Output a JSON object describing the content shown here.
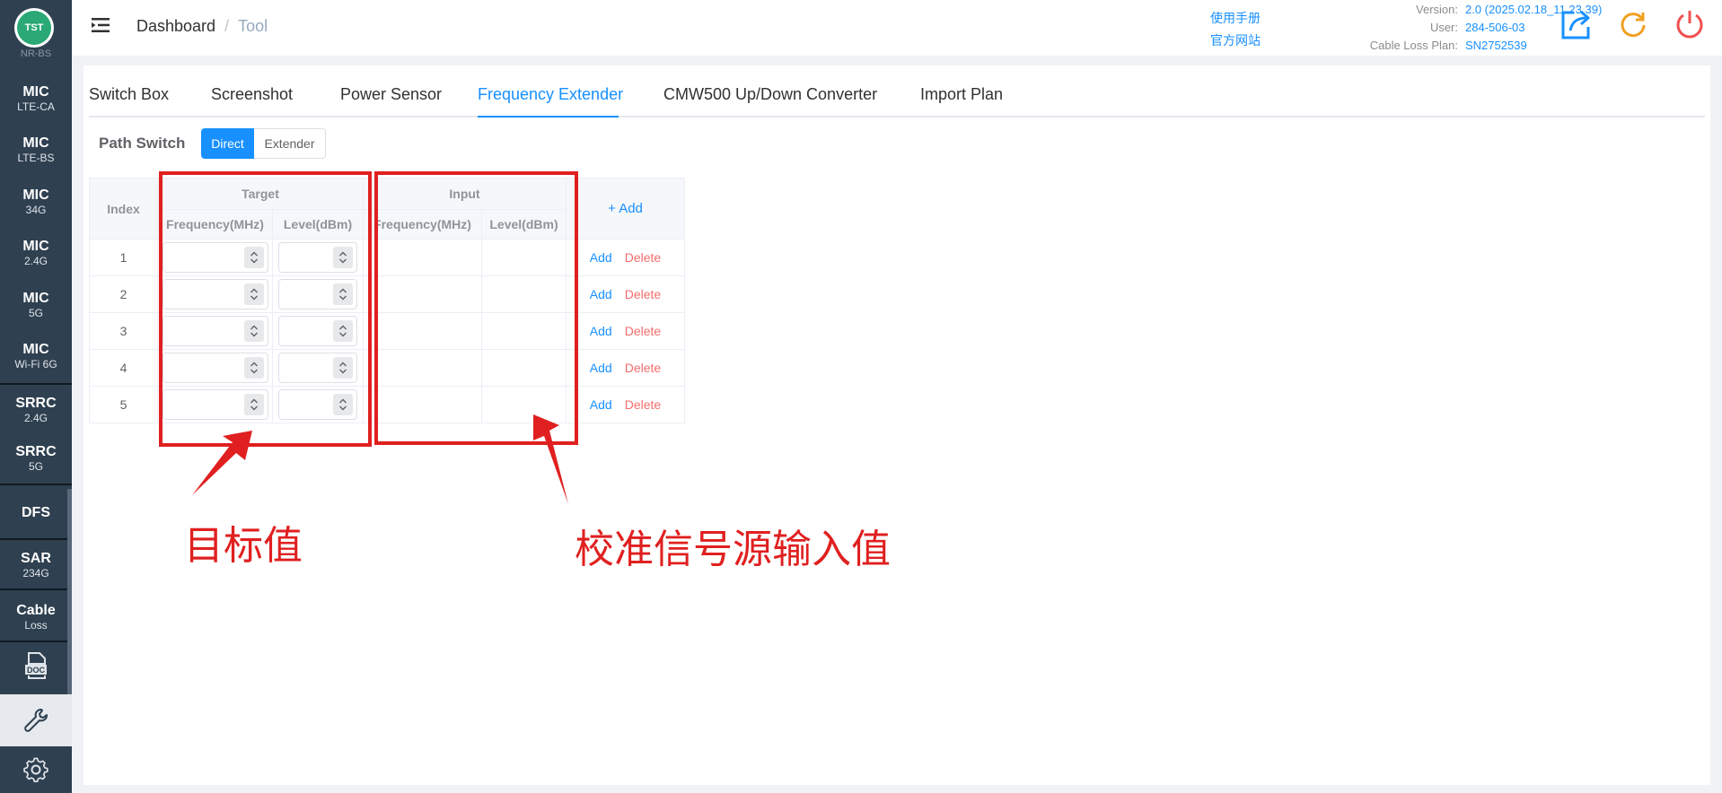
{
  "sidebar": {
    "logo_text": "TST",
    "cut_label": "NR-BS",
    "items": [
      {
        "title": "MIC",
        "sub": "LTE-CA"
      },
      {
        "title": "MIC",
        "sub": "LTE-BS"
      },
      {
        "title": "MIC",
        "sub": "34G"
      },
      {
        "title": "MIC",
        "sub": "2.4G"
      },
      {
        "title": "MIC",
        "sub": "5G"
      },
      {
        "title": "MIC",
        "sub": "Wi-Fi 6G"
      },
      {
        "title": "SRRC",
        "sub": "2.4G"
      },
      {
        "title": "SRRC",
        "sub": "5G"
      },
      {
        "title": "DFS",
        "sub": ""
      },
      {
        "title": "SAR",
        "sub": "234G"
      },
      {
        "title": "Cable",
        "sub": "Loss"
      }
    ],
    "doc_icon_text": "DOC"
  },
  "header": {
    "breadcrumb": {
      "home": "Dashboard",
      "sep": "/",
      "current": "Tool"
    },
    "links": [
      "使用手册",
      "官方网站"
    ],
    "info": [
      {
        "key": "Version:",
        "value": "2.0 (2025.02.18_11.23.39)"
      },
      {
        "key": "User:",
        "value": "284-506-03"
      },
      {
        "key": "Cable Loss Plan:",
        "value": "SN2752539"
      }
    ],
    "icon_colors": {
      "export": "#1890ff",
      "refresh": "#f0a020",
      "power": "#f05050"
    }
  },
  "tabs": [
    {
      "label": "Switch Box",
      "active": false
    },
    {
      "label": "Screenshot",
      "active": false
    },
    {
      "label": "Power Sensor",
      "active": false
    },
    {
      "label": "Frequency Extender",
      "active": true
    },
    {
      "label": "CMW500 Up/Down Converter",
      "active": false
    },
    {
      "label": "Import Plan",
      "active": false
    }
  ],
  "path_switch": {
    "label": "Path Switch",
    "options": [
      "Direct",
      "Extender"
    ],
    "selected": "Direct"
  },
  "table": {
    "index_header": "Index",
    "target_header": "Target",
    "input_header": "Input",
    "freq_header": "Frequency(MHz)",
    "level_header": "Level(dBm)",
    "add_header": "+ Add",
    "rows": [
      {
        "index": "1",
        "add": "Add",
        "delete": "Delete"
      },
      {
        "index": "2",
        "add": "Add",
        "delete": "Delete"
      },
      {
        "index": "3",
        "add": "Add",
        "delete": "Delete"
      },
      {
        "index": "4",
        "add": "Add",
        "delete": "Delete"
      },
      {
        "index": "5",
        "add": "Add",
        "delete": "Delete"
      }
    ]
  },
  "annotations": {
    "target_note": "目标值",
    "input_note": "校准信号源输入值",
    "color": "#e02020"
  }
}
